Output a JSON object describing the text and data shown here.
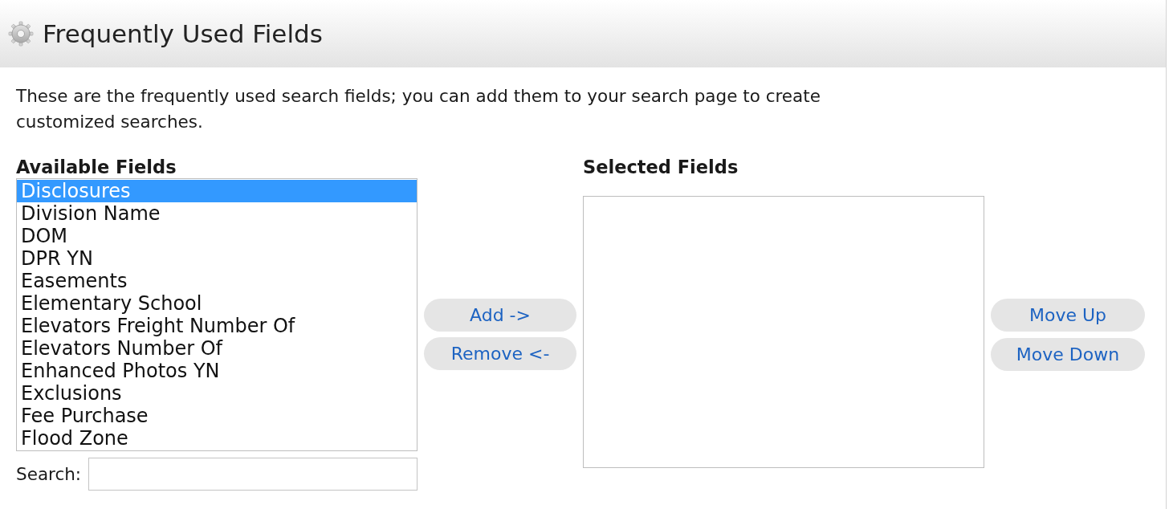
{
  "header": {
    "title": "Frequently Used Fields"
  },
  "description": "These are the frequently used search fields; you can add them to your search page to create customized searches.",
  "available_fields": {
    "label": "Available Fields",
    "items": [
      {
        "label": "Disclosures",
        "selected": true
      },
      {
        "label": "Division Name",
        "selected": false
      },
      {
        "label": "DOM",
        "selected": false
      },
      {
        "label": "DPR YN",
        "selected": false
      },
      {
        "label": "Easements",
        "selected": false
      },
      {
        "label": "Elementary School",
        "selected": false
      },
      {
        "label": "Elevators Freight Number Of",
        "selected": false
      },
      {
        "label": "Elevators Number Of",
        "selected": false
      },
      {
        "label": "Enhanced Photos YN",
        "selected": false
      },
      {
        "label": "Exclusions",
        "selected": false
      },
      {
        "label": "Fee Purchase",
        "selected": false
      },
      {
        "label": "Flood Zone",
        "selected": false
      }
    ]
  },
  "search": {
    "label": "Search:"
  },
  "transfer_buttons": [
    "Add ->",
    "Remove <-"
  ],
  "selected_fields": {
    "label": "Selected Fields"
  },
  "order_buttons": [
    "Move Up",
    "Move Down"
  ]
}
